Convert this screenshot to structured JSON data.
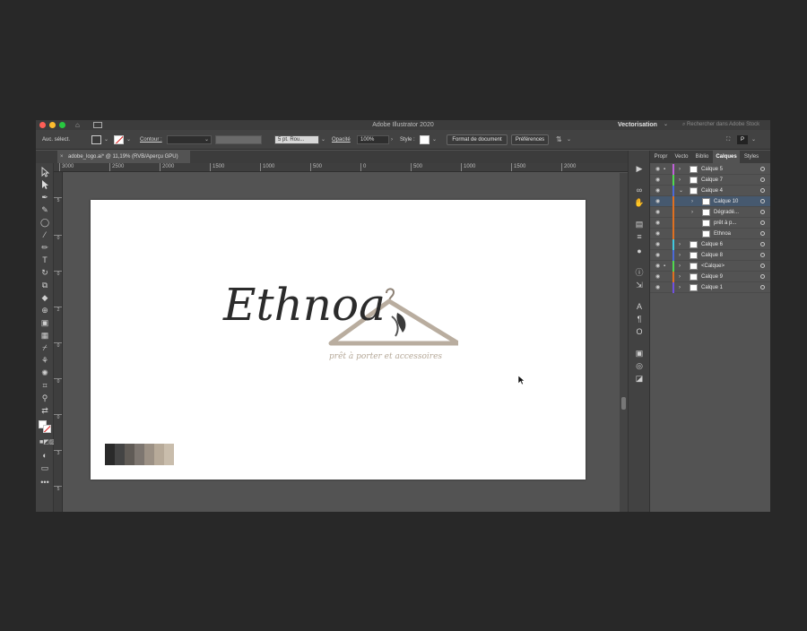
{
  "window": {
    "title": "Adobe Illustrator 2020"
  },
  "workspace": {
    "label": "Vectorisation",
    "search_placeholder": "Rechercher dans Adobe Stock"
  },
  "control_bar": {
    "selection": "Auc. sélect.",
    "stroke_label": "Contour :",
    "brush_value": "5 pt. Rou...",
    "opacity_label": "Opacité",
    "opacity_value": "100%",
    "style_label": "Style :",
    "document_setup": "Format de document",
    "preferences": "Préférences"
  },
  "document_tab": {
    "title": "adobe_logo.ai* @ 11,19% (RVB/Aperçu GPU)"
  },
  "ruler": {
    "top_ticks": [
      "3000",
      "2500",
      "2000",
      "1500",
      "1000",
      "500",
      "0",
      "500",
      "1000",
      "1500",
      "2000"
    ],
    "left_ticks": [
      "5",
      "0",
      "0",
      "2",
      "0",
      "0",
      "0",
      "3",
      "5"
    ]
  },
  "artwork": {
    "logo_text": "Ethnoa",
    "tagline": "prêt à porter et accessoires",
    "palette": [
      "#2a2a2a",
      "#444444",
      "#605b56",
      "#7d7670",
      "#9c9185",
      "#b7aa99",
      "#c9bdac"
    ]
  },
  "panel": {
    "tabs": [
      "Propr",
      "Vecto",
      "Biblio",
      "Calques",
      "Styles"
    ],
    "active_tab": "Calques",
    "layers": [
      {
        "name": "Calque 5",
        "color": "#c060d8",
        "locked": true,
        "expand": "›",
        "selected": false,
        "indent": 0
      },
      {
        "name": "Calque 7",
        "color": "#50d850",
        "locked": false,
        "expand": "›",
        "selected": false,
        "indent": 0
      },
      {
        "name": "Calque 4",
        "color": "#4a6ad8",
        "locked": false,
        "expand": "⌄",
        "selected": false,
        "indent": 0
      },
      {
        "name": "Calque 10",
        "color": "#e07020",
        "locked": false,
        "expand": "›",
        "selected": true,
        "indent": 1
      },
      {
        "name": "Dégradé...",
        "color": "#e07020",
        "locked": false,
        "expand": "›",
        "selected": false,
        "indent": 1
      },
      {
        "name": "prêt à p...",
        "color": "#e07020",
        "locked": false,
        "expand": "",
        "selected": false,
        "indent": 1
      },
      {
        "name": "Ethnoa",
        "color": "#e07020",
        "locked": false,
        "expand": "",
        "selected": false,
        "indent": 1
      },
      {
        "name": "Calque 6",
        "color": "#40c8e0",
        "locked": false,
        "expand": "›",
        "selected": false,
        "indent": 0
      },
      {
        "name": "Calque 8",
        "color": "#4a6ad8",
        "locked": false,
        "expand": "›",
        "selected": false,
        "indent": 0
      },
      {
        "name": "<Calque>",
        "color": "#50d850",
        "locked": true,
        "expand": "›",
        "selected": false,
        "indent": 0
      },
      {
        "name": "Calque 9",
        "color": "#e07020",
        "locked": false,
        "expand": "›",
        "selected": false,
        "indent": 0
      },
      {
        "name": "Calque 1",
        "color": "#7050e0",
        "locked": false,
        "expand": "›",
        "selected": false,
        "indent": 0
      }
    ]
  },
  "icons": {
    "eye": "◉",
    "lock": "🔒"
  }
}
